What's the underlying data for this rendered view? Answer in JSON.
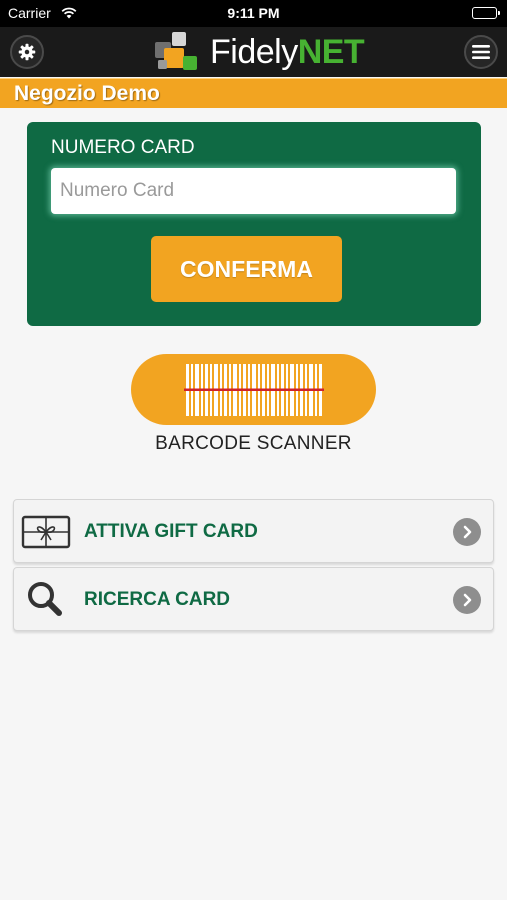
{
  "status_bar": {
    "carrier": "Carrier",
    "time": "9:11 PM"
  },
  "nav": {
    "logo_part1": "Fidely",
    "logo_part2": "NET"
  },
  "store": {
    "name": "Negozio Demo"
  },
  "card_form": {
    "label": "NUMERO CARD",
    "input_value": "",
    "input_placeholder": "Numero Card",
    "confirm_label": "CONFERMA"
  },
  "barcode": {
    "label": "BARCODE SCANNER"
  },
  "menu_items": [
    {
      "label": "ATTIVA GIFT CARD",
      "icon": "gift-card-icon"
    },
    {
      "label": "RICERCA CARD",
      "icon": "magnifier-icon"
    }
  ],
  "colors": {
    "accent_orange": "#f2a421",
    "brand_green": "#0f6a44",
    "logo_green": "#47b232",
    "nav_bg": "#1a1a1a"
  }
}
